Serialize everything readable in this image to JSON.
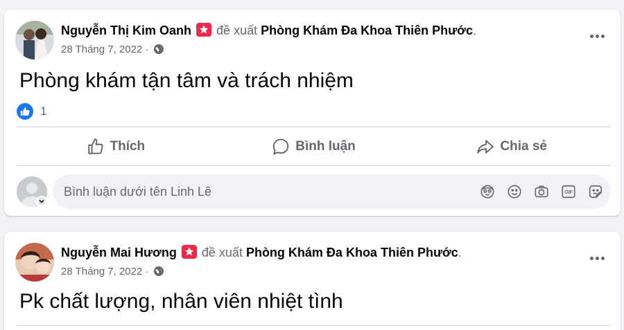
{
  "posts": [
    {
      "author": "Nguyễn Thị Kim Oanh",
      "recommends": "đề xuất",
      "page": "Phòng Khám Đa Khoa Thiên Phước",
      "period": ".",
      "date": "28 Tháng 7, 2022",
      "separator": "·",
      "text": "Phòng khám tận tâm và trách nhiệm",
      "reaction_count": "1",
      "actions": {
        "like": "Thích",
        "comment": "Bình luận",
        "share": "Chia sẻ"
      },
      "comment_placeholder": "Bình luận dưới tên Linh Lê"
    },
    {
      "author": "Nguyễn Mai Hương",
      "recommends": "đề xuất",
      "page": "Phòng Khám Đa Khoa Thiên Phước",
      "period": ".",
      "date": "28 Tháng 7, 2022",
      "separator": "·",
      "text": "Pk chất lượng, nhân viên nhiệt tình"
    }
  ],
  "icons": {
    "recommend": "recommend-star-icon",
    "privacy": "globe-icon",
    "more": "more-dots-icon",
    "like": "thumbs-up-icon",
    "comment": "speech-bubble-icon",
    "share": "share-arrow-icon",
    "composer_tools": [
      "avatar-sticker-icon",
      "emoji-icon",
      "camera-icon",
      "gif-icon",
      "sticker-icon"
    ]
  },
  "colors": {
    "accent": "#1877f2",
    "recommend": "#f02849",
    "muted": "#65676b",
    "background": "#f0f2f5"
  }
}
